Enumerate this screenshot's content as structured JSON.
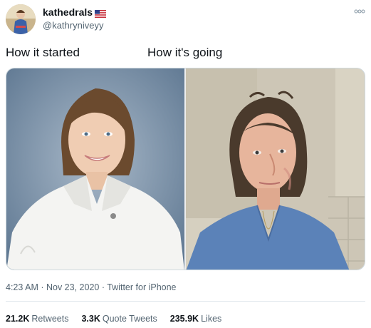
{
  "author": {
    "display_name": "kathedrals",
    "handle": "@kathryniveyy",
    "flag_icon": "us-flag-icon"
  },
  "more_icon": "more-dots-icon",
  "tweet": {
    "text_left": "How it started",
    "text_right": "How it's going"
  },
  "meta": {
    "time": "4:23 AM",
    "sep1": " · ",
    "date": "Nov 23, 2020",
    "sep2": " · ",
    "source": "Twitter for iPhone"
  },
  "stats": [
    {
      "count": "21.2K",
      "label": "Retweets"
    },
    {
      "count": "3.3K",
      "label": "Quote Tweets"
    },
    {
      "count": "235.9K",
      "label": "Likes"
    }
  ],
  "colors": {
    "text": "#0f1419",
    "secondary": "#536471",
    "border": "#e1e8ed",
    "scrubs": "#5b82b8",
    "portrait_bg": "#7e97b3"
  }
}
